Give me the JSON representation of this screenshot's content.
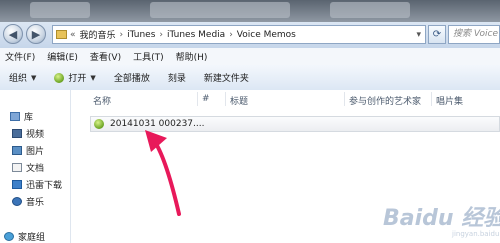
{
  "address_bar": {
    "overflow": "«",
    "crumbs": [
      "我的音乐",
      "iTunes",
      "iTunes Media",
      "Voice Memos"
    ],
    "separator": "›",
    "dropdown": "▾"
  },
  "search": {
    "placeholder": "搜索 Voice M"
  },
  "menu": [
    "文件(F)",
    "编辑(E)",
    "查看(V)",
    "工具(T)",
    "帮助(H)"
  ],
  "toolbar": {
    "organize": "组织",
    "open": "打开",
    "play_all": "全部播放",
    "burn": "刻录",
    "new_folder": "新建文件夹"
  },
  "sidebar": {
    "items": [
      {
        "label": "库",
        "icon": "library-icon"
      },
      {
        "label": "视频",
        "icon": "video-icon"
      },
      {
        "label": "图片",
        "icon": "picture-icon"
      },
      {
        "label": "文档",
        "icon": "document-icon"
      },
      {
        "label": "迅雷下载",
        "icon": "thunder-download-icon"
      },
      {
        "label": "音乐",
        "icon": "music-icon"
      },
      {
        "label": "家庭组",
        "icon": "homegroup-icon"
      }
    ]
  },
  "columns": [
    "名称",
    "#",
    "标题",
    "参与创作的艺术家",
    "唱片集"
  ],
  "files": [
    {
      "name": "20141031 000237....",
      "icon": "audio-file-icon"
    }
  ],
  "watermark": {
    "text": "Baidu 经验",
    "sub": "jingyan.baidu.com"
  },
  "colors": {
    "accent": "#e8195a",
    "selection_border": "#d5dae0"
  }
}
